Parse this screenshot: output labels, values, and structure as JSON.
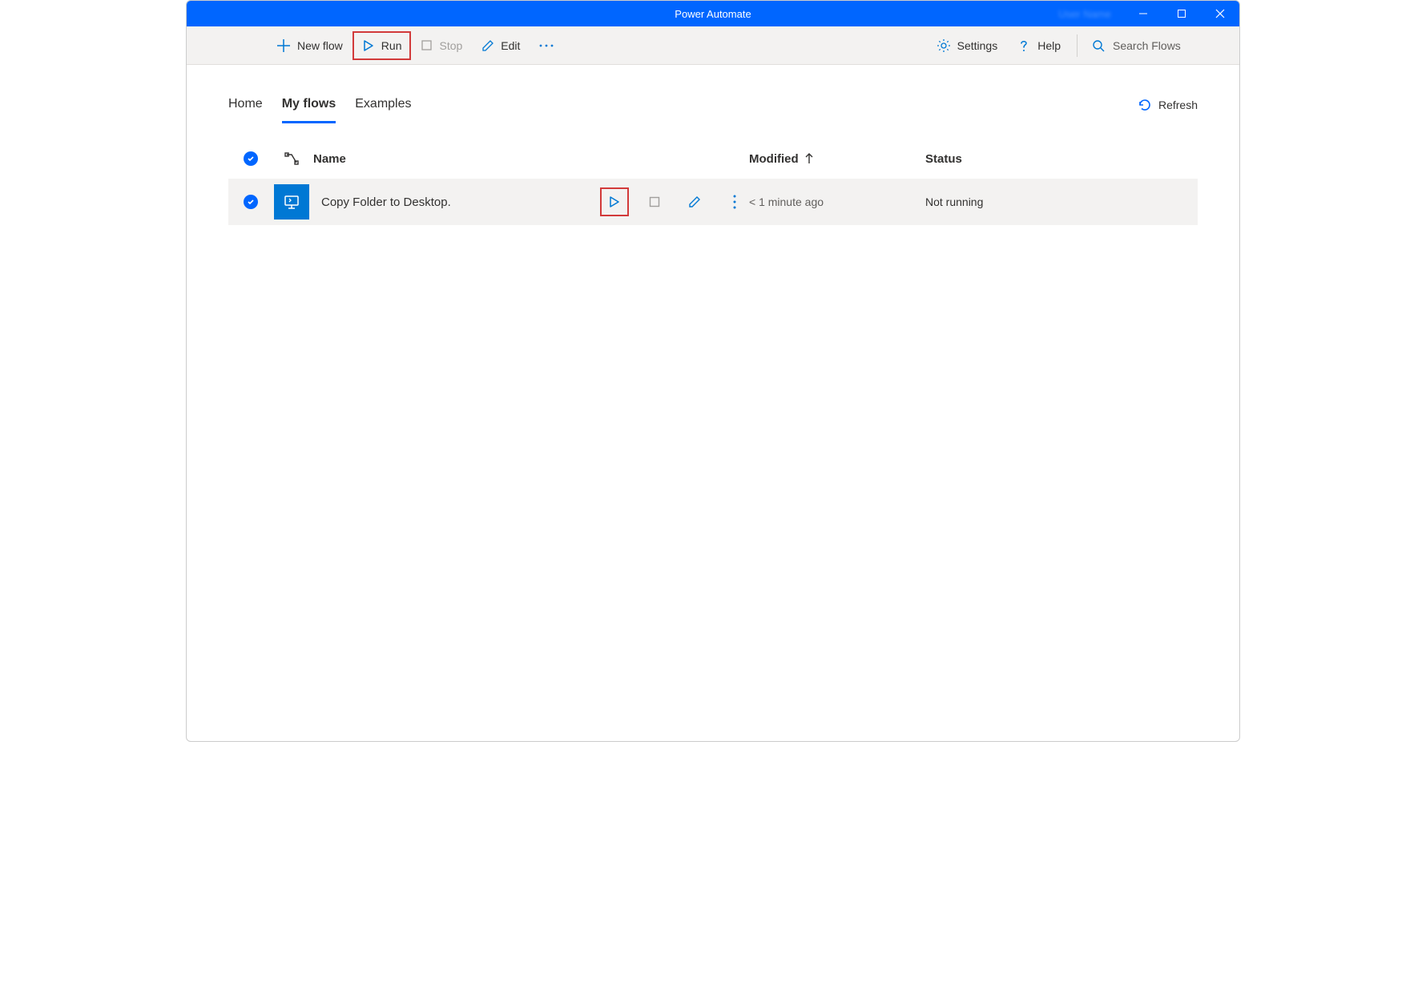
{
  "titlebar": {
    "title": "Power Automate",
    "user": "User Name"
  },
  "toolbar": {
    "new_flow": "New flow",
    "run": "Run",
    "stop": "Stop",
    "edit": "Edit",
    "settings": "Settings",
    "help": "Help",
    "search_placeholder": "Search Flows"
  },
  "tabs": {
    "home": "Home",
    "my_flows": "My flows",
    "examples": "Examples",
    "refresh": "Refresh"
  },
  "table": {
    "header": {
      "name": "Name",
      "modified": "Modified",
      "status": "Status"
    },
    "rows": [
      {
        "name": "Copy Folder to Desktop.",
        "modified": "< 1 minute ago",
        "status": "Not running"
      }
    ]
  }
}
